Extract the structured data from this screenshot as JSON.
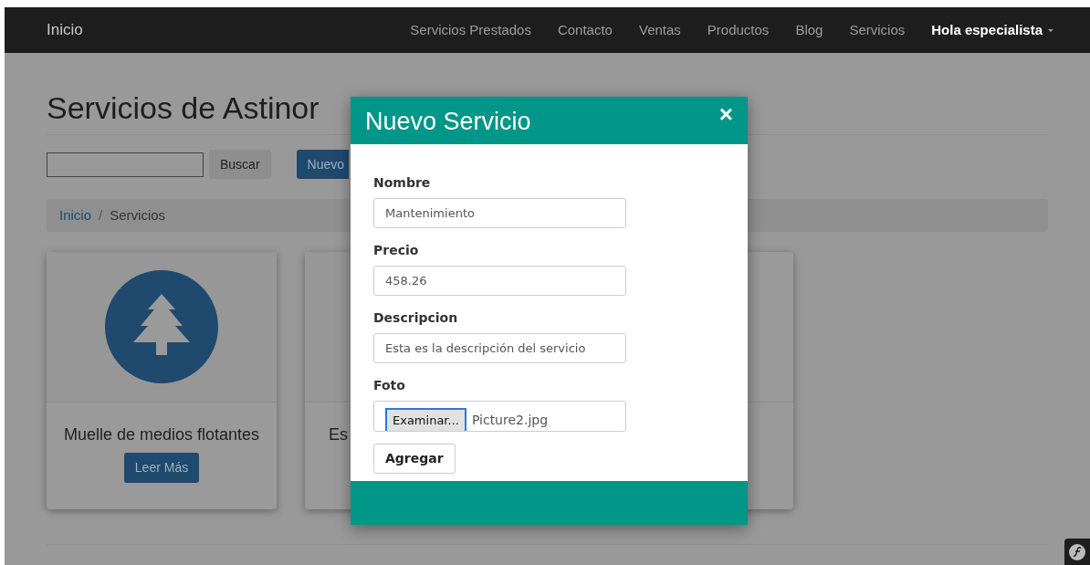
{
  "navbar": {
    "brand": "Inicio",
    "links": [
      "Servicios Prestados",
      "Contacto",
      "Ventas",
      "Productos",
      "Blog",
      "Servicios"
    ],
    "user_menu": "Hola especialista"
  },
  "page": {
    "title": "Servicios de Astinor",
    "search_button": "Buscar",
    "new_button": "Nuevo",
    "breadcrumb_separator": "/",
    "breadcrumb": [
      {
        "label": "Inicio",
        "kind": "link"
      },
      {
        "label": "Servicios",
        "kind": "current"
      }
    ],
    "cards": [
      {
        "kind": "full",
        "title": "Muelle de medios flotantes",
        "button": "Leer Más"
      },
      {
        "kind": "partial",
        "title": "Es"
      },
      {
        "kind": "covered"
      }
    ]
  },
  "modal": {
    "title": "Nuevo Servicio",
    "close": "×",
    "fields": [
      {
        "label": "Nombre",
        "kind": "text",
        "value": "Mantenimiento"
      },
      {
        "label": "Precio",
        "kind": "text",
        "value": "458.26"
      },
      {
        "label": "Descripcion",
        "kind": "text",
        "value": "Esta es la descripción del servicio"
      },
      {
        "label": "Foto",
        "kind": "file",
        "button": "Examinar...",
        "value": "Picture2.jpg"
      }
    ],
    "submit": "Agregar"
  }
}
